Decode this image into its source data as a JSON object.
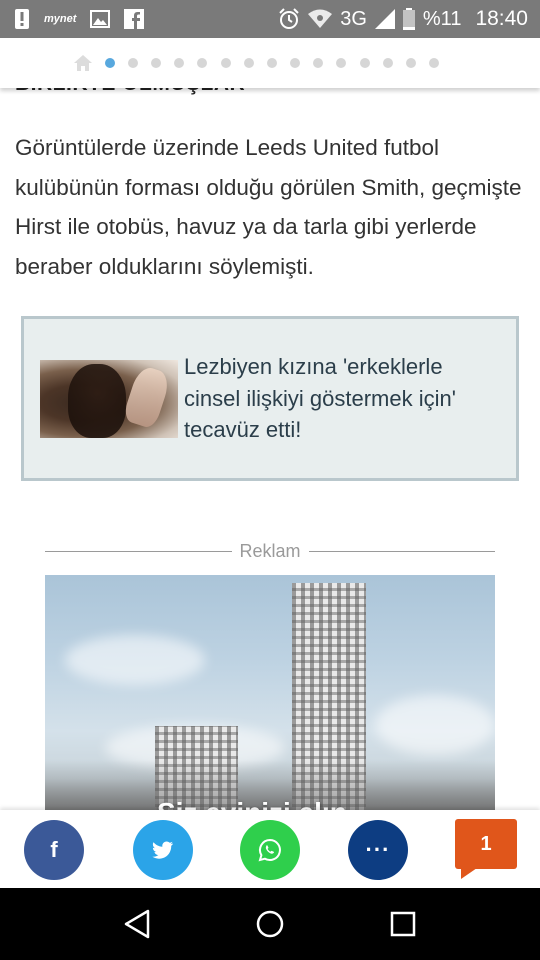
{
  "status_bar": {
    "network": "3G",
    "battery": "%11",
    "time": "18:40",
    "mynet_label": "mynet",
    "icons": [
      "alert-icon",
      "mynet-icon",
      "image-icon",
      "facebook-icon",
      "alarm-icon",
      "wifi-icon",
      "signal-icon",
      "battery-icon"
    ]
  },
  "page_nav": {
    "dots_total": 15,
    "active_index": 0,
    "active_color": "#58a8de",
    "inactive_color": "#d6d6d6"
  },
  "article": {
    "cut_heading": "BİRLİKTE OLMUŞLAR",
    "paragraph": "Görüntülerde üzerinde Leeds United futbol kulübünün forması olduğu görülen Smith, geçmişte Hirst ile otobüs, havuz ya da tarla gibi yerlerde beraber olduklarını söylemişti."
  },
  "related": {
    "title": "Lezbiyen kızına 'erkeklerle cinsel ilişkiyi göstermek için' tecavüz etti!"
  },
  "ad": {
    "label": "Reklam",
    "caption": "Siz evinizi alın"
  },
  "share": {
    "facebook_label": "f",
    "more_label": "···",
    "comment_count": "1",
    "colors": {
      "facebook": "#3b5998",
      "twitter": "#2ba4e8",
      "whatsapp": "#2fcf4c",
      "more": "#0d3d82",
      "comments": "#e0561b"
    }
  },
  "nav_bar": {
    "icons": [
      "back-icon",
      "home-icon",
      "recents-icon"
    ]
  }
}
